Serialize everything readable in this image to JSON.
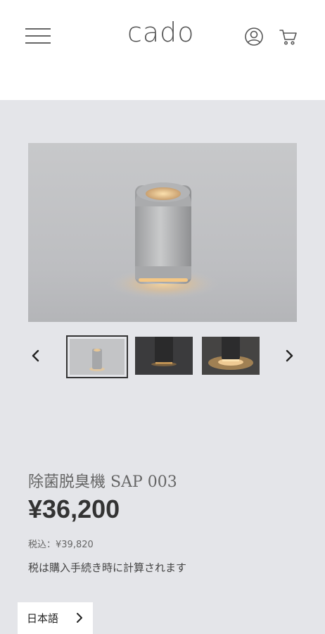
{
  "header": {
    "logo_text": "cado",
    "menu_icon": "hamburger-menu-icon",
    "account_icon": "user-icon",
    "cart_icon": "cart-icon"
  },
  "gallery": {
    "prev_icon": "chevron-left-icon",
    "next_icon": "chevron-right-icon",
    "thumbnail_count": 3,
    "selected_thumbnail": 1
  },
  "product": {
    "title": "除菌脱臭機 SAP 003",
    "price": "¥36,200",
    "tax_included": "税込：¥39,820",
    "tax_note": "税は購入手続き時に計算されます"
  },
  "language": {
    "label": "日本語",
    "icon": "chevron-right-icon"
  },
  "colors": {
    "page_background": "#e4e5e9",
    "header_background": "#ffffff",
    "text_primary": "#333333",
    "glow": "#f3c98a"
  }
}
